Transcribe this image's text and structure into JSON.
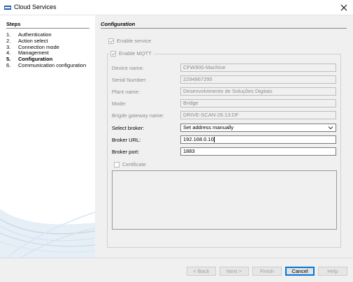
{
  "window": {
    "title": "Cloud Services",
    "accent_color": "#0078d7"
  },
  "sidebar": {
    "heading": "Steps",
    "steps": [
      {
        "num": "1.",
        "label": "Authentication"
      },
      {
        "num": "2.",
        "label": "Action select"
      },
      {
        "num": "3.",
        "label": "Connection mode"
      },
      {
        "num": "4.",
        "label": "Management"
      },
      {
        "num": "5.",
        "label": "Configuration"
      },
      {
        "num": "6.",
        "label": "Communication configuration"
      }
    ],
    "active_step": 4
  },
  "config": {
    "heading": "Configuration",
    "enable_service": {
      "label": "Enable service",
      "checked": true
    },
    "enable_mqtt": {
      "label": "Enable MQTT",
      "checked": true
    },
    "fields": {
      "device_name": {
        "label": "Device name:",
        "value": "CFW900-Machine"
      },
      "serial_number": {
        "label": "Serial Number:",
        "value": "2294967295"
      },
      "plant_name": {
        "label": "Plant name:",
        "value": "Desenvolvimento de Soluções Digitais"
      },
      "mode": {
        "label": "Mode:",
        "value": "Bridge"
      },
      "bridge_gateway": {
        "label": "Brigde gateway name:",
        "value": "DRIVE-SCAN-26:13:DF"
      },
      "select_broker": {
        "label": "Select broker:",
        "value": "Set address manually"
      },
      "broker_url": {
        "label": "Broker URL:",
        "value": "192.168.0.10"
      },
      "broker_port": {
        "label": "Broker port:",
        "value": "1883"
      }
    },
    "certificate": {
      "label": "Certificate",
      "checked": false
    }
  },
  "buttons": {
    "back": "< Back",
    "next": "Next >",
    "finish": "Finish",
    "cancel": "Cancel",
    "help": "Help"
  }
}
